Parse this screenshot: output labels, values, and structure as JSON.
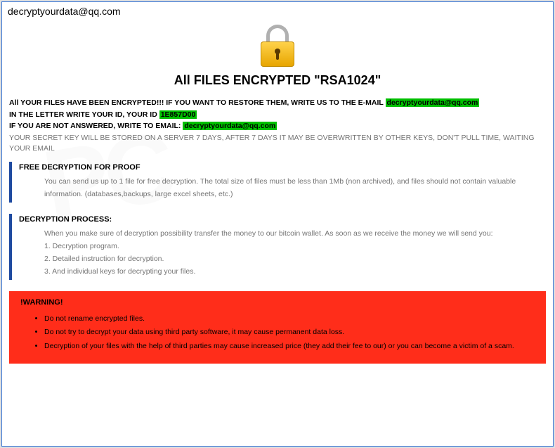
{
  "window": {
    "title": "decryptyourdata@qq.com"
  },
  "headline": "All FILES ENCRYPTED \"RSA1024\"",
  "intro": {
    "line1_prefix": "All YOUR FILES HAVE BEEN ENCRYPTED!!! IF YOU WANT TO RESTORE THEM, WRITE US TO THE E-MAIL ",
    "email1": "decryptyourdata@qq.com",
    "line2_prefix": "IN THE LETTER WRITE YOUR ID, YOUR ID ",
    "id": "1E857D00",
    "line3_prefix": "IF YOU ARE NOT ANSWERED, WRITE TO EMAIL: ",
    "email2": "decryptyourdata@qq.com",
    "note": "YOUR SECRET KEY WILL BE STORED ON A SERVER 7 DAYS, AFTER 7 DAYS IT MAY BE OVERWRITTEN BY OTHER KEYS, DON'T PULL TIME, WAITING YOUR EMAIL"
  },
  "sections": {
    "proof": {
      "title": "FREE DECRYPTION FOR PROOF",
      "body": "You can send us up to 1 file for free decryption. The total size of files must be less than 1Mb (non archived), and files should not contain valuable information. (databases,backups, large excel sheets, etc.)"
    },
    "process": {
      "title": "DECRYPTION PROCESS:",
      "intro": "When you make sure of decryption possibility transfer the money to our bitcoin wallet. As soon as we receive the money we will send you:",
      "step1": "1. Decryption program.",
      "step2": "2. Detailed instruction for decryption.",
      "step3": "3. And individual keys for decrypting your files."
    }
  },
  "warning": {
    "title": "!WARNING!",
    "items": [
      "Do not rename encrypted files.",
      "Do not try to decrypt your data using third party software, it may cause permanent data loss.",
      "Decryption of your files with the help of third parties may cause increased price (they add their fee to our) or you can become a victim of a scam."
    ]
  }
}
